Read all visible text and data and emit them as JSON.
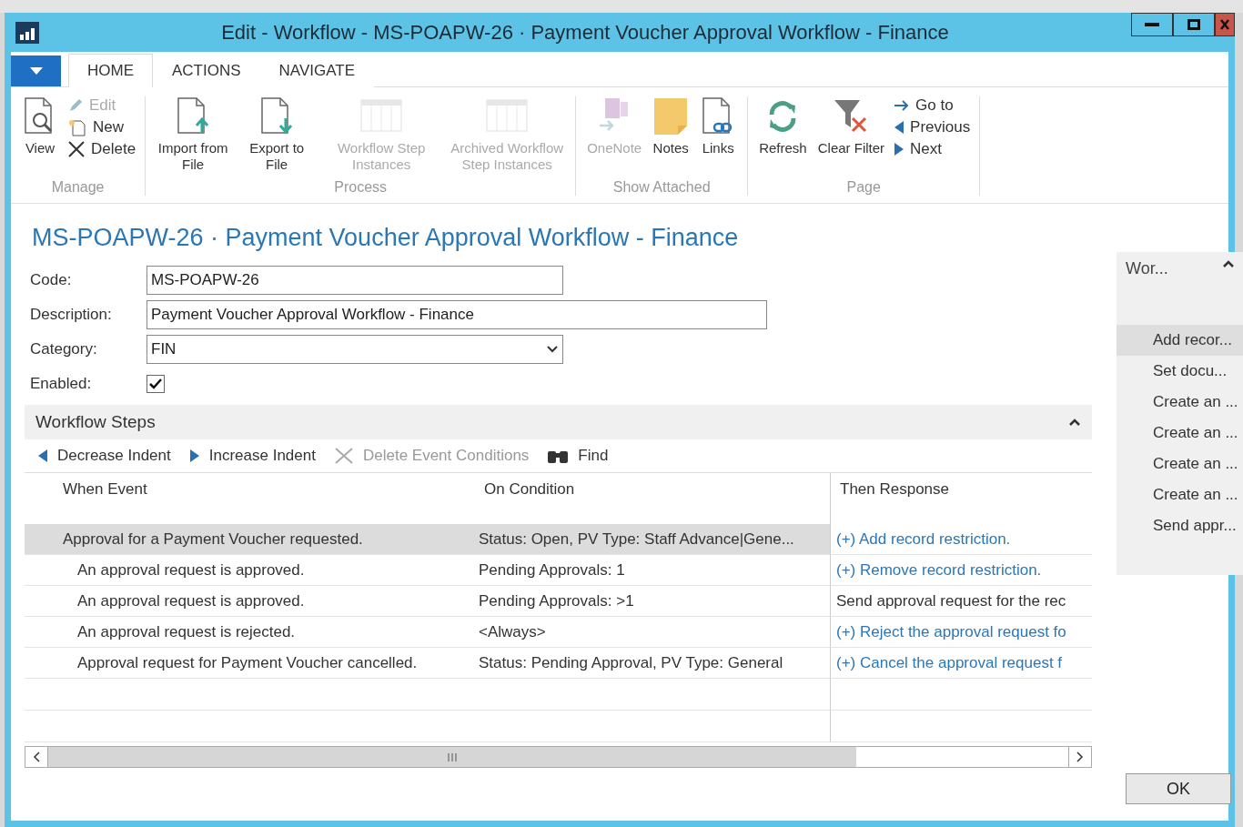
{
  "window": {
    "title": "Edit - Workflow - MS-POAPW-26 · Payment Voucher Approval Workflow - Finance"
  },
  "ribbon_tabs": [
    {
      "label": "HOME",
      "selected": true
    },
    {
      "label": "ACTIONS",
      "selected": false
    },
    {
      "label": "NAVIGATE",
      "selected": false
    }
  ],
  "ribbon_groups": [
    {
      "label": "Manage",
      "items": [
        {
          "kind": "large",
          "label": "View",
          "disabled": false
        },
        {
          "kind": "stack",
          "items": [
            {
              "label": "Edit",
              "disabled": true
            },
            {
              "label": "New",
              "disabled": false
            },
            {
              "label": "Delete",
              "disabled": false
            }
          ]
        }
      ]
    },
    {
      "label": "Process",
      "items": [
        {
          "kind": "large",
          "label": "Import from File",
          "disabled": false
        },
        {
          "kind": "large",
          "label": "Export to File",
          "disabled": false
        },
        {
          "kind": "large",
          "label": "Workflow Step Instances",
          "disabled": true
        },
        {
          "kind": "large",
          "label": "Archived Workflow Step Instances",
          "disabled": true
        }
      ]
    },
    {
      "label": "Show Attached",
      "items": [
        {
          "kind": "large",
          "label": "OneNote",
          "disabled": true
        },
        {
          "kind": "large",
          "label": "Notes",
          "disabled": false
        },
        {
          "kind": "large",
          "label": "Links",
          "disabled": false
        }
      ]
    },
    {
      "label": "Page",
      "items": [
        {
          "kind": "large",
          "label": "Refresh",
          "disabled": false
        },
        {
          "kind": "large",
          "label": "Clear Filter",
          "disabled": false
        },
        {
          "kind": "stack",
          "items": [
            {
              "label": "Go to",
              "disabled": false
            },
            {
              "label": "Previous",
              "disabled": false
            },
            {
              "label": "Next",
              "disabled": false
            }
          ]
        }
      ]
    }
  ],
  "page_title": "MS-POAPW-26 · Payment Voucher Approval Workflow - Finance",
  "fields": [
    {
      "kind": "text",
      "label": "Code:",
      "value": "MS-POAPW-26"
    },
    {
      "kind": "wide",
      "label": "Description:",
      "value": "Payment Voucher Approval Workflow - Finance"
    },
    {
      "kind": "select",
      "label": "Category:",
      "value": "FIN"
    },
    {
      "kind": "checkbox",
      "label": "Enabled:",
      "checked": true
    }
  ],
  "workflow_steps": {
    "title": "Workflow Steps",
    "actions": [
      {
        "label": "Decrease Indent",
        "disabled": false
      },
      {
        "label": "Increase Indent",
        "disabled": false
      },
      {
        "label": "Delete Event Conditions",
        "disabled": true
      },
      {
        "label": "Find",
        "disabled": false
      }
    ],
    "columns": [
      "When Event",
      "On Condition",
      "Then Response"
    ],
    "rows": [
      {
        "event": "Approval for a Payment Voucher requested.",
        "condition": "Status: Open, PV Type: Staff Advance|Gene...",
        "response": "(+) Add record restriction.",
        "kind": "link",
        "selected": true,
        "children": [
          {
            "event": "An approval request is approved.",
            "condition": "Pending Approvals: 1",
            "response": "(+) Remove record restriction.",
            "kind": "link",
            "selected": false
          },
          {
            "event": "An approval request is approved.",
            "condition": "Pending Approvals: >1",
            "response": "Send approval request for the rec",
            "kind": "text",
            "selected": false
          },
          {
            "event": "An approval request is rejected.",
            "condition": "<Always>",
            "response": "(+) Reject the approval request fo",
            "kind": "link",
            "selected": false
          },
          {
            "event": "Approval request for Payment Voucher cancelled.",
            "condition": "Status: Pending Approval, PV Type: General",
            "response": "(+) Cancel the approval request f",
            "kind": "link",
            "selected": false
          }
        ]
      }
    ]
  },
  "factbox": {
    "title": "Wor...",
    "items": [
      {
        "label": "Add recor...",
        "selected": true
      },
      {
        "label": "Set docu...",
        "selected": false
      },
      {
        "label": "Create an ...",
        "selected": false
      },
      {
        "label": "Create an ...",
        "selected": false
      },
      {
        "label": "Create an ...",
        "selected": false
      },
      {
        "label": "Create an ...",
        "selected": false
      },
      {
        "label": "Send appr...",
        "selected": false
      }
    ]
  },
  "buttons": [
    {
      "label": "OK"
    }
  ]
}
